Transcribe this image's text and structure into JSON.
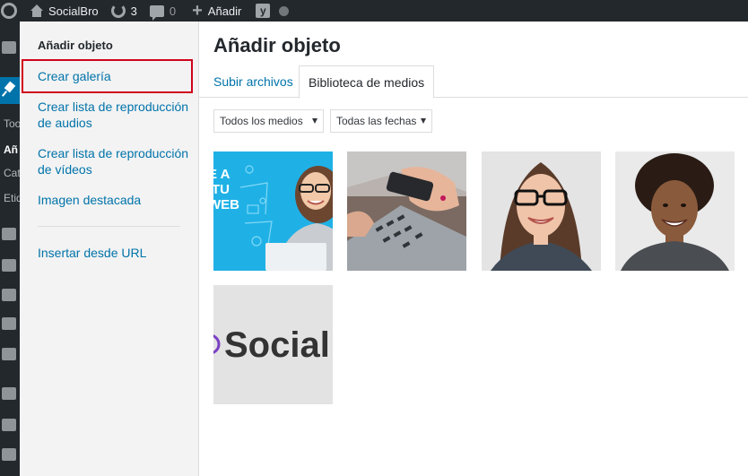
{
  "adminbar": {
    "site_name": "SocialBro",
    "updates_count": "3",
    "comments_count": "0",
    "new_label": "Añadir",
    "icons": [
      "wordpress-icon",
      "home-icon",
      "updates-icon",
      "comments-icon",
      "plus-icon",
      "yoast-icon",
      "status-dot-icon"
    ]
  },
  "adminmenu": {
    "partial_labels": [
      "Too",
      "Añ",
      "Cat",
      "Etiq"
    ]
  },
  "media_menu": {
    "title": "Añadir objeto",
    "items": [
      {
        "label": "Crear galería"
      },
      {
        "label": "Crear lista de reproducción de audios"
      },
      {
        "label": "Crear lista de reproducción de vídeos"
      },
      {
        "label": "Imagen destacada"
      },
      {
        "label": "Insertar desde URL"
      }
    ]
  },
  "frame": {
    "title": "Añadir objeto",
    "tabs": [
      {
        "label": "Subir archivos",
        "active": false
      },
      {
        "label": "Biblioteca de medios",
        "active": true
      }
    ],
    "filters": [
      {
        "selected": "Todos los medios"
      },
      {
        "selected": "Todas las fechas"
      }
    ]
  },
  "attachments": [
    {
      "subject": "banner with woman and laptop",
      "text_lines": [
        "E A",
        "TU",
        "WEB"
      ]
    },
    {
      "subject": "hands with smartphone and laptop"
    },
    {
      "subject": "woman with glasses"
    },
    {
      "subject": "smiling man with curly hair"
    },
    {
      "subject": "SocialBro logo",
      "text": "Social"
    }
  ],
  "colors": {
    "admin_bg": "#23282d",
    "link": "#0073aa",
    "highlight_border": "#d0021b",
    "menu_bg": "#f3f3f3"
  }
}
